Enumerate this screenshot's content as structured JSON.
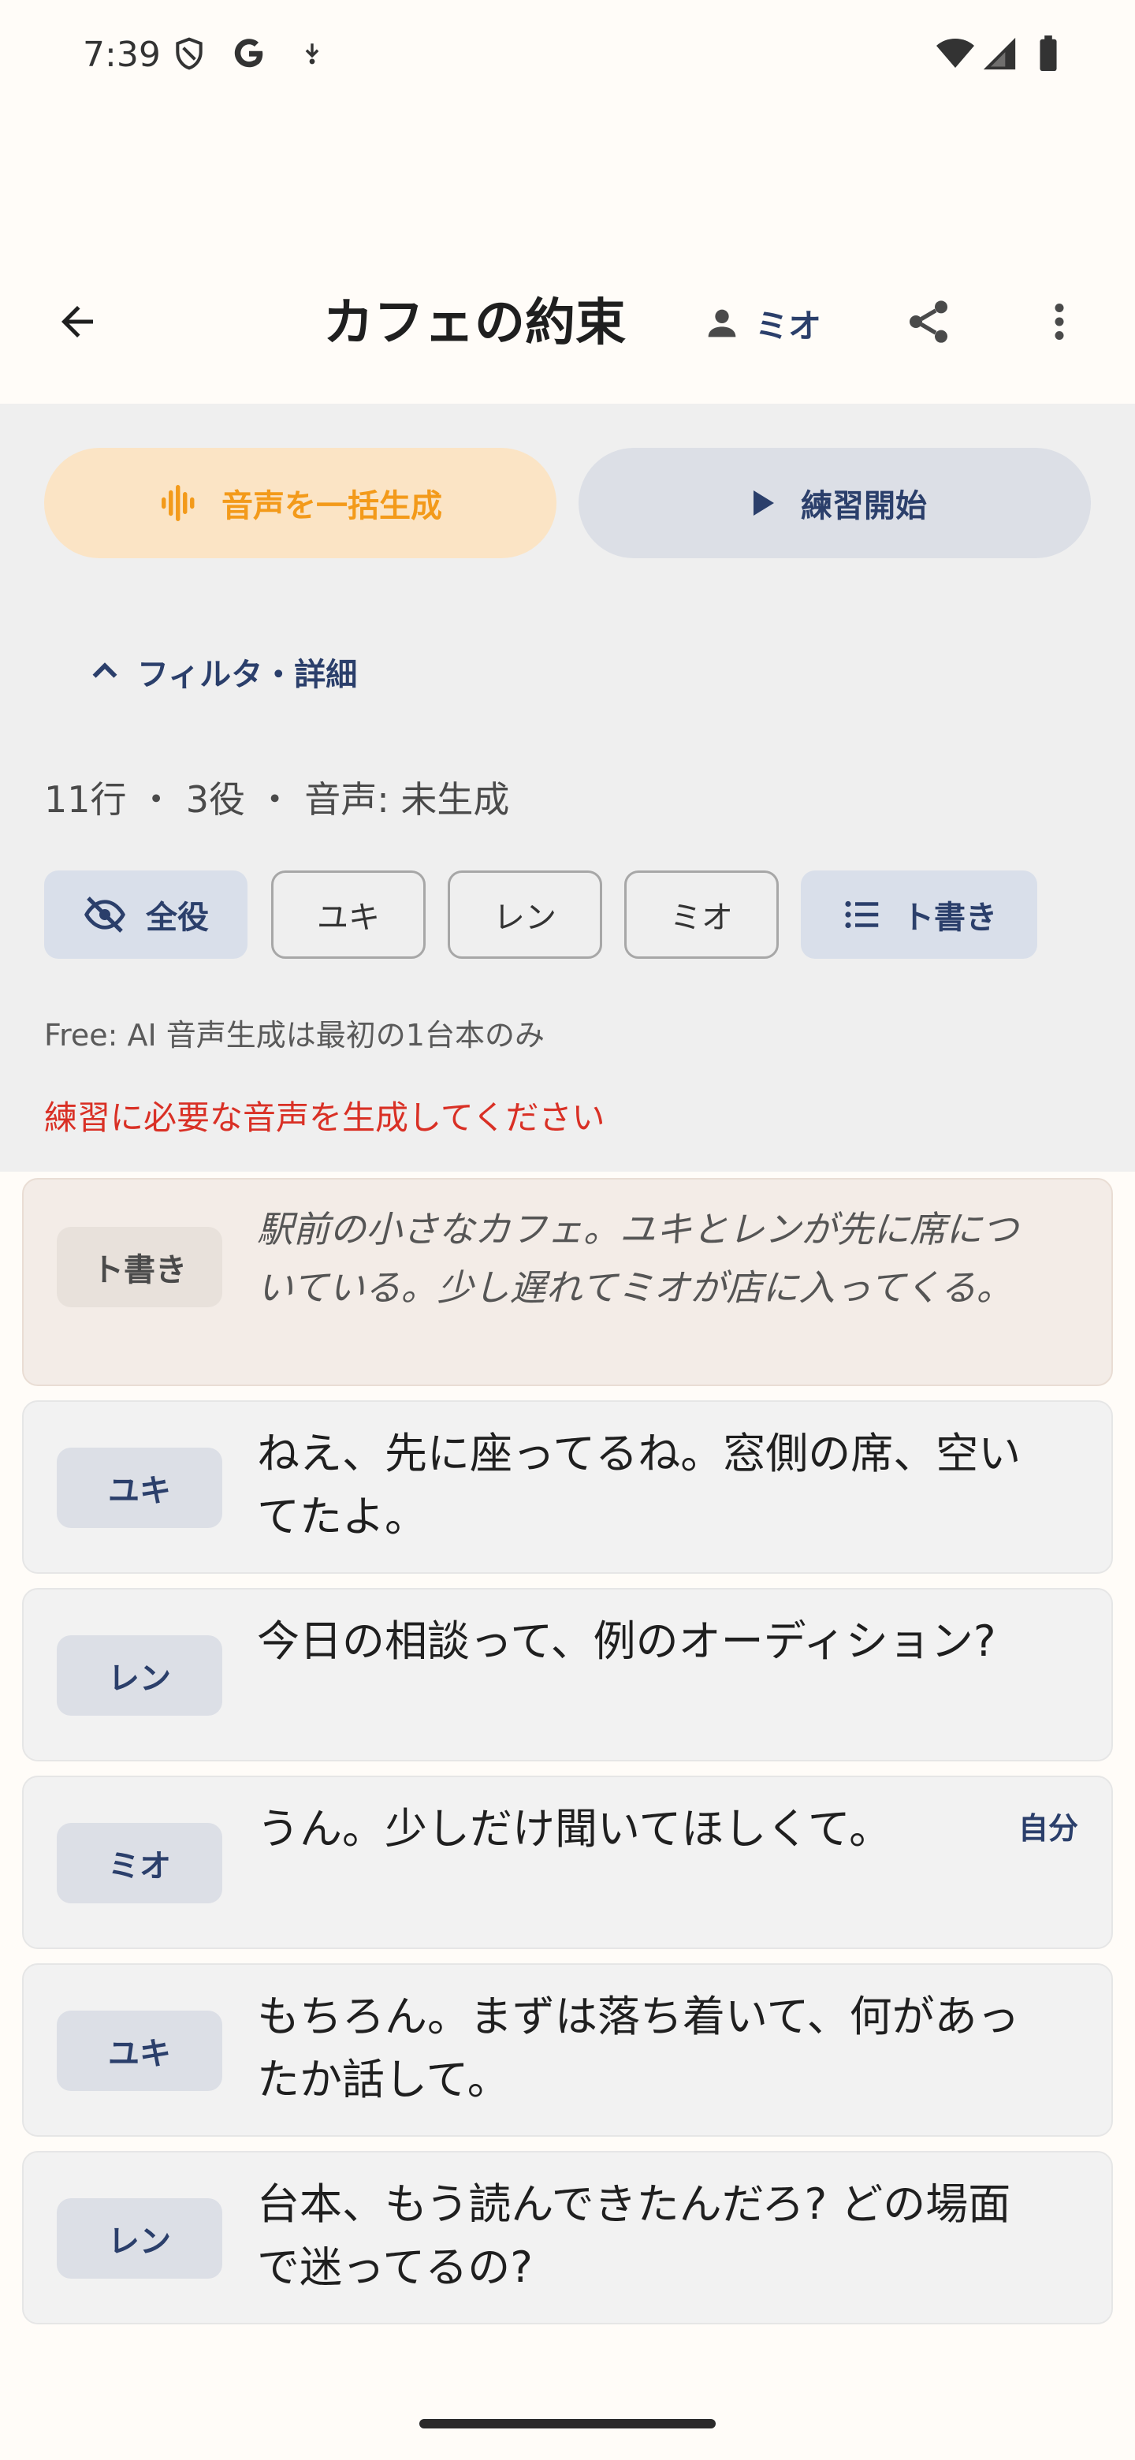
{
  "status_bar": {
    "time": "7:39",
    "icons": [
      "shield-icon",
      "google-icon",
      "download-icon",
      "wifi-icon",
      "signal-icon",
      "battery-icon"
    ]
  },
  "app_bar": {
    "title": "カフェの約束",
    "role_label": "ミオ",
    "icons": [
      "back-arrow-icon",
      "person-icon",
      "share-icon",
      "more-vert-icon"
    ]
  },
  "actions": {
    "generate_label": "音声を一括生成",
    "practice_label": "練習開始"
  },
  "filter": {
    "toggle_label": "フィルタ・詳細"
  },
  "stats": "11行 ・ 3役 ・ 音声: 未生成",
  "chips": [
    {
      "label": "全役",
      "icon": "eye-off-icon",
      "selected": true
    },
    {
      "label": "ユキ",
      "selected": false
    },
    {
      "label": "レン",
      "selected": false
    },
    {
      "label": "ミオ",
      "selected": false
    },
    {
      "label": "ト書き",
      "icon": "list-icon",
      "selected": true
    }
  ],
  "free_note": "Free: AI 音声生成は最初の1台本のみ",
  "warning": "練習に必要な音声を生成してください",
  "lines": [
    {
      "speaker": "ト書き",
      "text": "駅前の小さなカフェ。ユキとレンが先に席についている。少し遅れてミオが店に入ってくる。",
      "type": "direction"
    },
    {
      "speaker": "ユキ",
      "text": "ねえ、先に座ってるね。窓側の席、空いてたよ。",
      "type": "line"
    },
    {
      "speaker": "レン",
      "text": "今日の相談って、例のオーディション?",
      "type": "line"
    },
    {
      "speaker": "ミオ",
      "text": "うん。少しだけ聞いてほしくて。",
      "type": "line",
      "tag": "自分"
    },
    {
      "speaker": "ユキ",
      "text": "もちろん。まずは落ち着いて、何があったか話して。",
      "type": "line"
    },
    {
      "speaker": "レン",
      "text": "台本、もう読んできたんだろ? どの場面で迷ってるの?",
      "type": "line"
    }
  ],
  "colors": {
    "accent": "#2B3F6B",
    "generate": "#F39A1A",
    "warning": "#D93025"
  }
}
